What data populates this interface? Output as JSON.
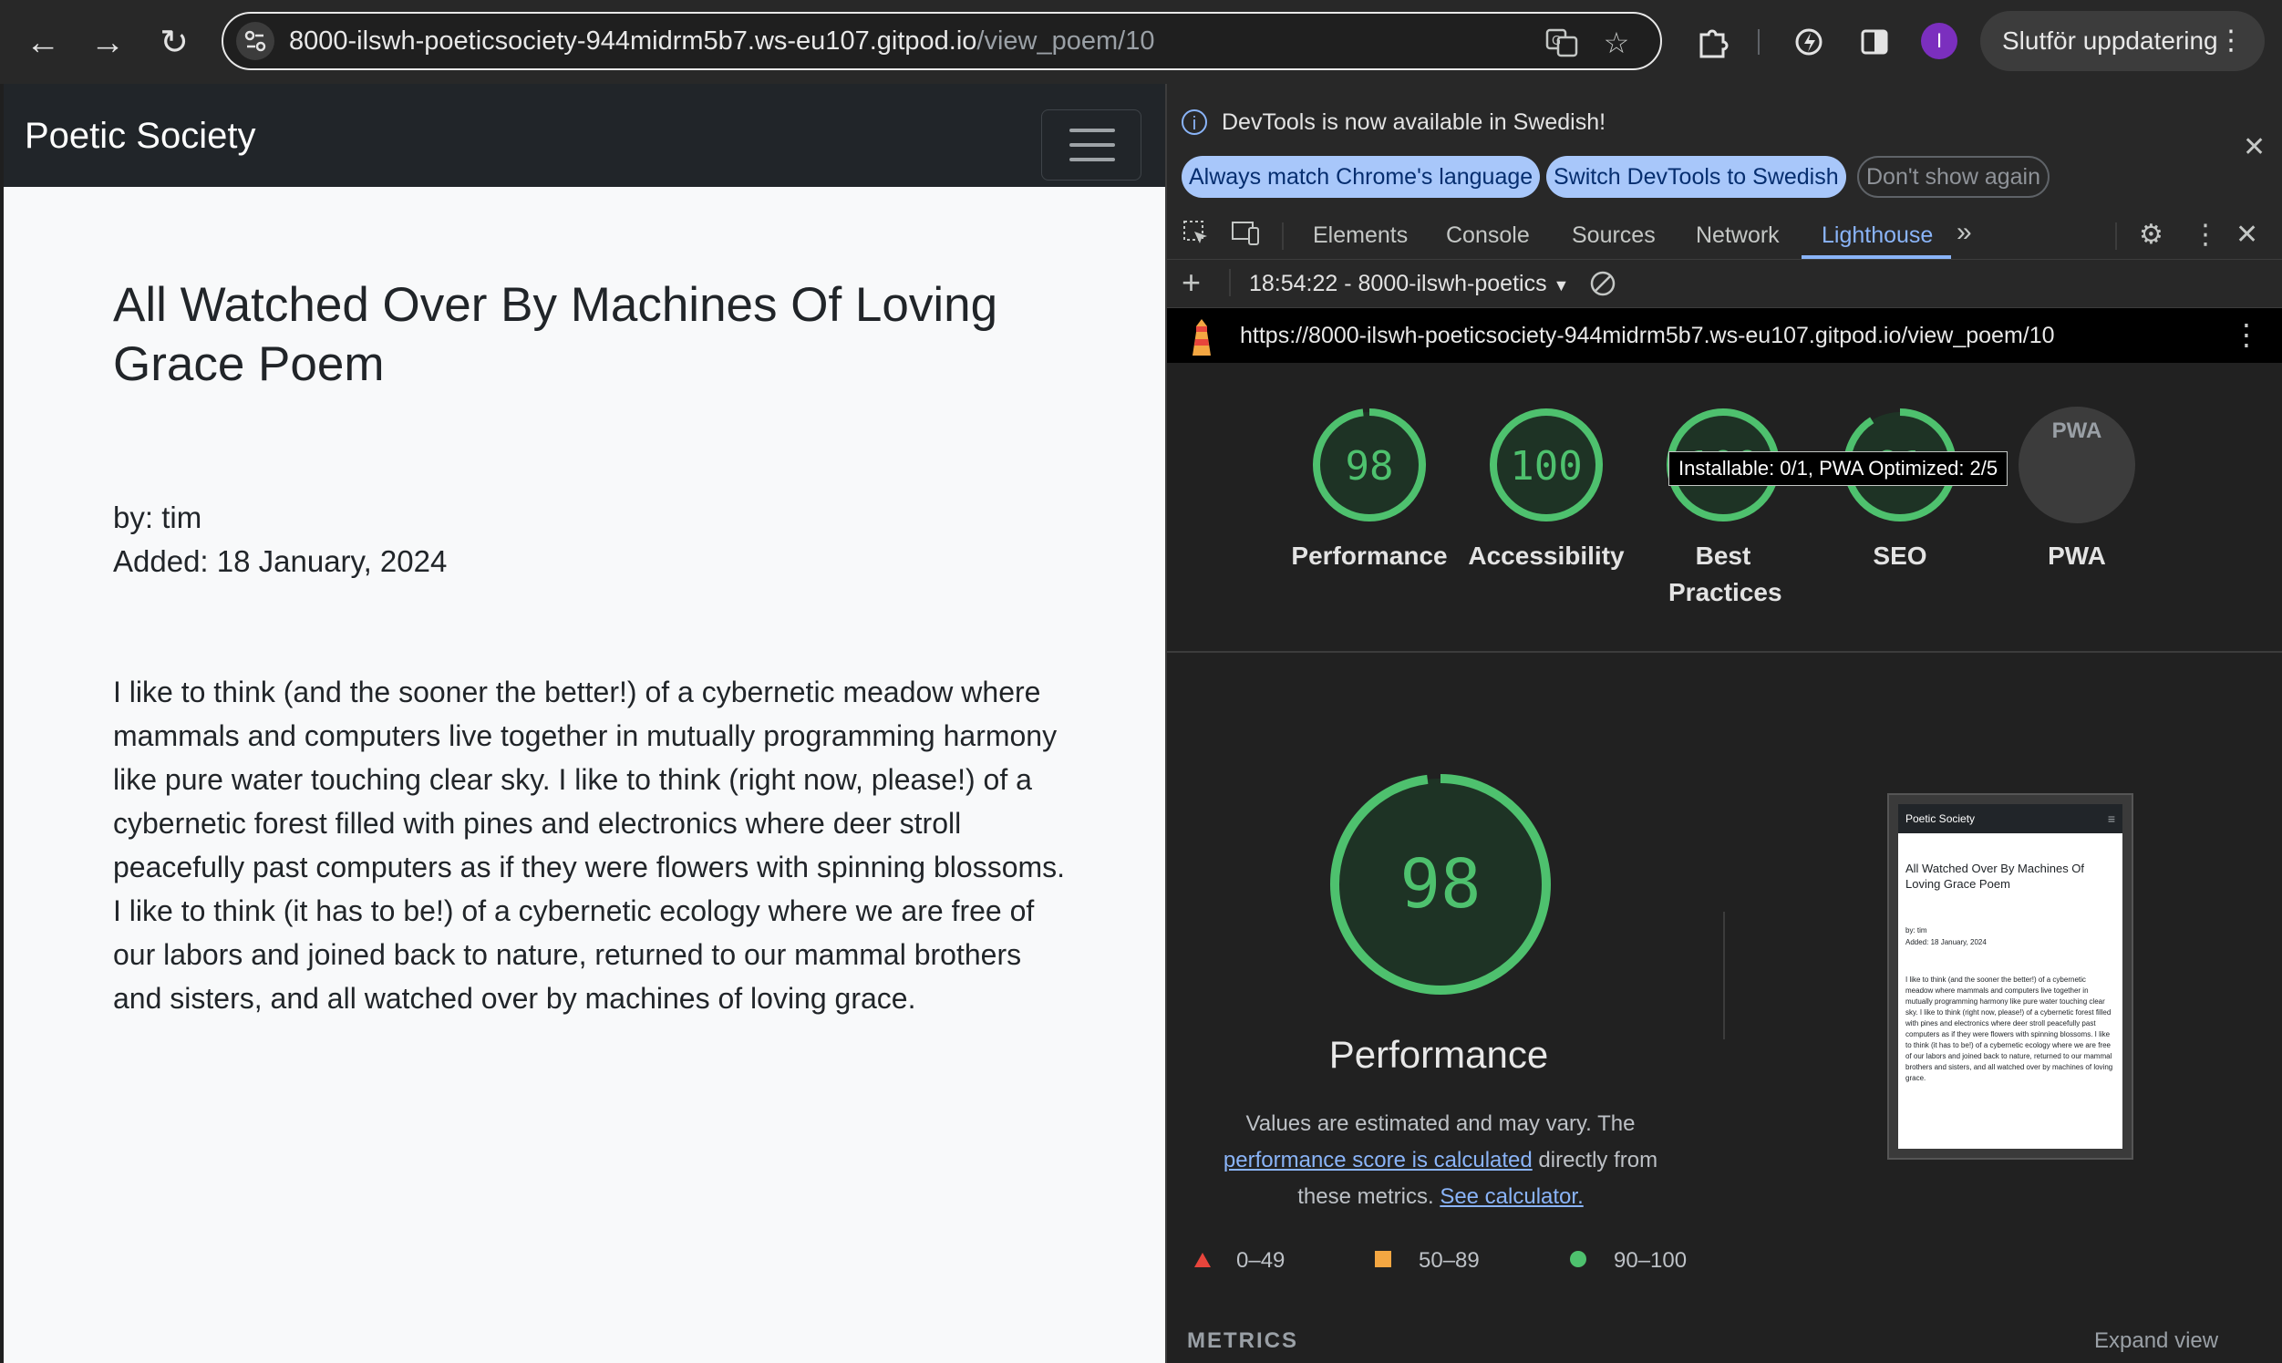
{
  "browser": {
    "url_host": "8000-ilswh-poeticsociety-944midrm5b7.ws-eu107.gitpod.io",
    "url_path": "/view_poem/10",
    "profile_initial": "I",
    "update_label": "Slutför uppdatering"
  },
  "site": {
    "brand": "Poetic Society",
    "poem": {
      "title": "All Watched Over By Machines Of Loving Grace Poem",
      "author": "by: tim",
      "added": "Added: 18 January, 2024",
      "body": "I like to think (and the sooner the better!) of a cybernetic meadow where mammals and computers live together in mutually programming harmony like pure water touching clear sky. I like to think (right now, please!) of a cybernetic forest filled with pines and electronics where deer stroll peacefully past computers as if they were flowers with spinning blossoms. I like to think (it has to be!) of a cybernetic ecology where we are free of our labors and joined back to nature, returned to our mammal brothers and sisters, and all watched over by machines of loving grace."
    }
  },
  "devtools": {
    "infobar": {
      "message": "DevTools is now available in Swedish!",
      "btn_match": "Always match Chrome's language",
      "btn_switch": "Switch DevTools to Swedish",
      "btn_dismiss": "Don't show again"
    },
    "tabs": {
      "elements": "Elements",
      "console": "Console",
      "sources": "Sources",
      "network": "Network",
      "lighthouse": "Lighthouse"
    },
    "report_selector": "18:54:22 - 8000-ilswh-poetics",
    "report_url": "https://8000-ilswh-poeticsociety-944midrm5b7.ws-eu107.gitpod.io/view_poem/10",
    "scores": [
      {
        "score": "98",
        "label": "Performance",
        "value": 98
      },
      {
        "score": "100",
        "label": "Accessibility",
        "value": 100
      },
      {
        "score": "100",
        "label": "Best Practices",
        "value": 100
      },
      {
        "score": "91",
        "label": "SEO",
        "value": 91
      },
      {
        "score": "PWA",
        "label": "PWA"
      }
    ],
    "tooltip": "Installable: 0/1, PWA Optimized: 2/5",
    "main_score": "98",
    "main_label": "Performance",
    "desc_1": "Values are estimated and may vary. The",
    "desc_link_1": "performance score is calculated",
    "desc_2": "directly from these metrics.",
    "desc_link_2": "See calculator.",
    "legend": {
      "fail": "0–49",
      "average": "50–89",
      "pass": "90–100"
    },
    "metrics_label": "METRICS",
    "expand_label": "Expand view",
    "thumbnail": {
      "brand": "Poetic Society",
      "title": "All Watched Over By Machines Of Loving Grace Poem",
      "author": "by: tim",
      "added": "Added: 18 January, 2024"
    },
    "colors": {
      "pass": "#4ec16e",
      "average": "#f4a742",
      "fail": "#e8453c"
    }
  }
}
